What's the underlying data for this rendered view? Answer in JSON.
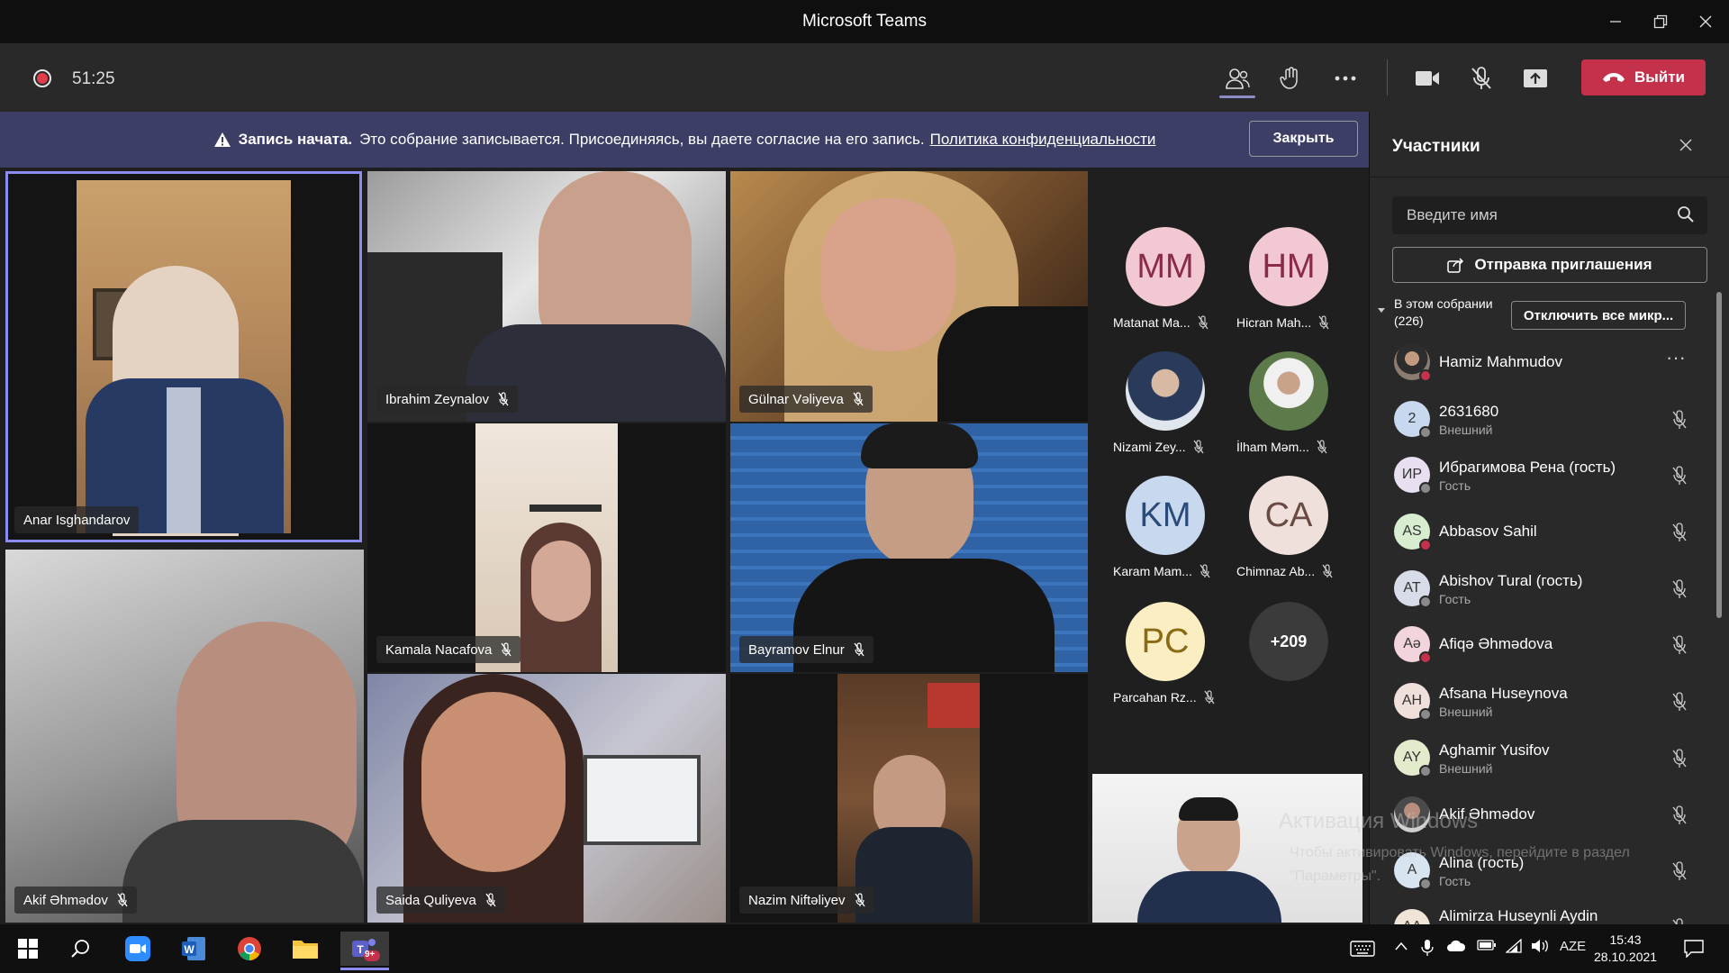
{
  "window": {
    "title": "Microsoft Teams"
  },
  "toolbar": {
    "timer": "51:25",
    "leave_label": "Выйти"
  },
  "banner": {
    "strong": "Запись начата.",
    "text": "Это собрание записывается. Присоединяясь, вы даете согласие на его запись.",
    "link": "Политика конфиденциальности",
    "close_label": "Закрыть"
  },
  "tiles": [
    {
      "name": "Anar Isghandarov"
    },
    {
      "name": "Ibrahim Zeynalov"
    },
    {
      "name": "Gülnar Vəliyeva"
    },
    {
      "name": "Kamala Nacafova"
    },
    {
      "name": "Bayramov Elnur"
    },
    {
      "name": "Akif Əhmədov"
    },
    {
      "name": "Saida Quliyeva"
    },
    {
      "name": "Nazim Niftəliyev"
    }
  ],
  "avatars": [
    {
      "initials": "MM",
      "name": "Matanat Ma..."
    },
    {
      "initials": "HM",
      "name": "Hicran Mah..."
    },
    {
      "initials": "",
      "name": "Nizami Zey..."
    },
    {
      "initials": "",
      "name": "İlham Məm..."
    },
    {
      "initials": "KM",
      "name": "Karam Mam..."
    },
    {
      "initials": "CA",
      "name": "Chimnaz Ab..."
    },
    {
      "initials": "PC",
      "name": "Parcahan Rz..."
    },
    {
      "initials": "+209",
      "name": ""
    }
  ],
  "panel": {
    "title": "Участники",
    "search_placeholder": "Введите имя",
    "invite_label": "Отправка приглашения",
    "section_label": "В этом собрании",
    "section_count": "(226)",
    "mute_all_label": "Отключить все микр...",
    "participants": [
      {
        "initials": "",
        "name": "Hamiz Mahmudov",
        "sub": ""
      },
      {
        "initials": "2",
        "name": "2631680",
        "sub": "Внешний"
      },
      {
        "initials": "ИР",
        "name": "Ибрагимова Рена (гость)",
        "sub": "Гость"
      },
      {
        "initials": "AS",
        "name": "Abbasov Sahil",
        "sub": ""
      },
      {
        "initials": "AT",
        "name": "Abishov Tural (гость)",
        "sub": "Гость"
      },
      {
        "initials": "Aə",
        "name": "Afiqə Əhmədova",
        "sub": ""
      },
      {
        "initials": "AH",
        "name": "Afsana Huseynova",
        "sub": "Внешний"
      },
      {
        "initials": "AY",
        "name": "Aghamir Yusifov",
        "sub": "Внешний"
      },
      {
        "initials": "",
        "name": "Akif Əhmədov",
        "sub": ""
      },
      {
        "initials": "A",
        "name": "Alina (гость)",
        "sub": "Гость"
      },
      {
        "initials": "AA",
        "name": "Alimirza Huseynli Aydin",
        "sub": ""
      }
    ]
  },
  "watermark": {
    "title": "Активация Windows",
    "text": "Чтобы активировать Windows, перейдите в раздел \"Параметры\"."
  },
  "taskbar": {
    "lang": "AZE",
    "time": "15:43",
    "date": "28.10.2021",
    "teams_badge": "9+"
  },
  "colors": {
    "leave": "#c4314b",
    "banner": "#3d3e66",
    "accent": "#8b8cf0"
  }
}
